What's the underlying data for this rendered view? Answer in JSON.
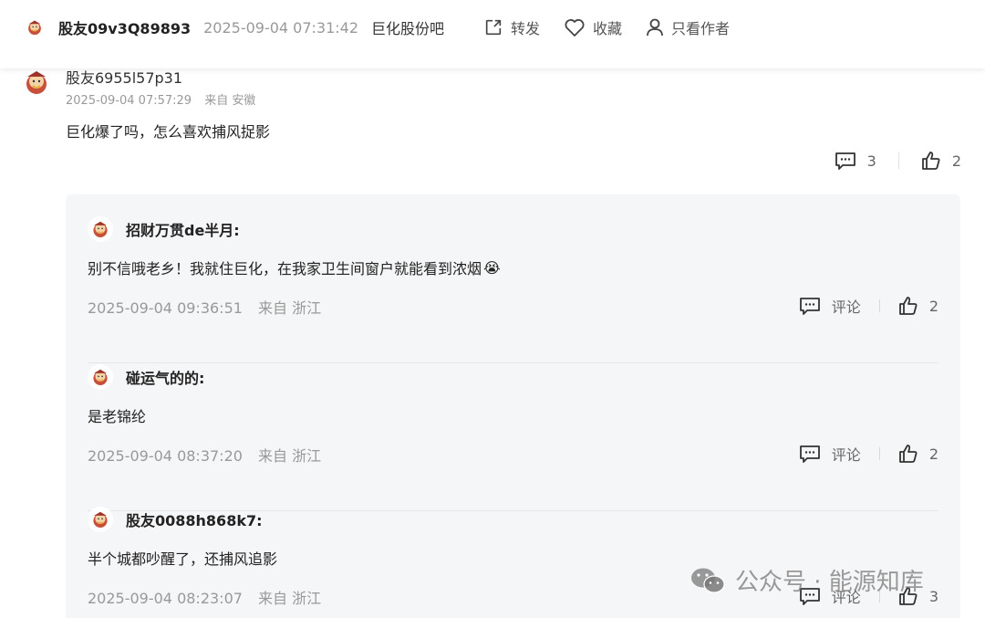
{
  "header": {
    "username": "股友09v3Q89893",
    "timestamp": "2025-09-04 07:31:42",
    "bar_name": "巨化股份吧",
    "actions": [
      {
        "icon": "share-icon",
        "label": "转发"
      },
      {
        "icon": "heart-icon",
        "label": "收藏"
      },
      {
        "icon": "user-icon",
        "label": "只看作者"
      }
    ]
  },
  "comment": {
    "username": "股友6955l57p31",
    "timestamp": "2025-09-04 07:57:29",
    "location": "来自 安徽",
    "text": "巨化爆了吗，怎么喜欢捕风捉影",
    "reply_count": "3",
    "like_count": "2"
  },
  "replies": [
    {
      "username": "招财万贯de半月:",
      "text": "别不信哦老乡！我就住巨化，在我家卫生间窗户就能看到浓烟",
      "emoji": "😭",
      "timestamp": "2025-09-04 09:36:51",
      "location": "来自 浙江",
      "reply_label": "评论",
      "likes": "2"
    },
    {
      "username": "碰运气的的:",
      "text": "是老锦纶",
      "emoji": "",
      "timestamp": "2025-09-04 08:37:20",
      "location": "来自 浙江",
      "reply_label": "评论",
      "likes": "2"
    },
    {
      "username": "股友0088h868k7:",
      "text": "半个城都吵醒了，还捕风追影",
      "emoji": "",
      "timestamp": "2025-09-04 08:23:07",
      "location": "来自 浙江",
      "reply_label": "评论",
      "likes": "3"
    }
  ],
  "watermark": {
    "text": "公众号 · 能源知库",
    "icon": "wechat-icon"
  }
}
